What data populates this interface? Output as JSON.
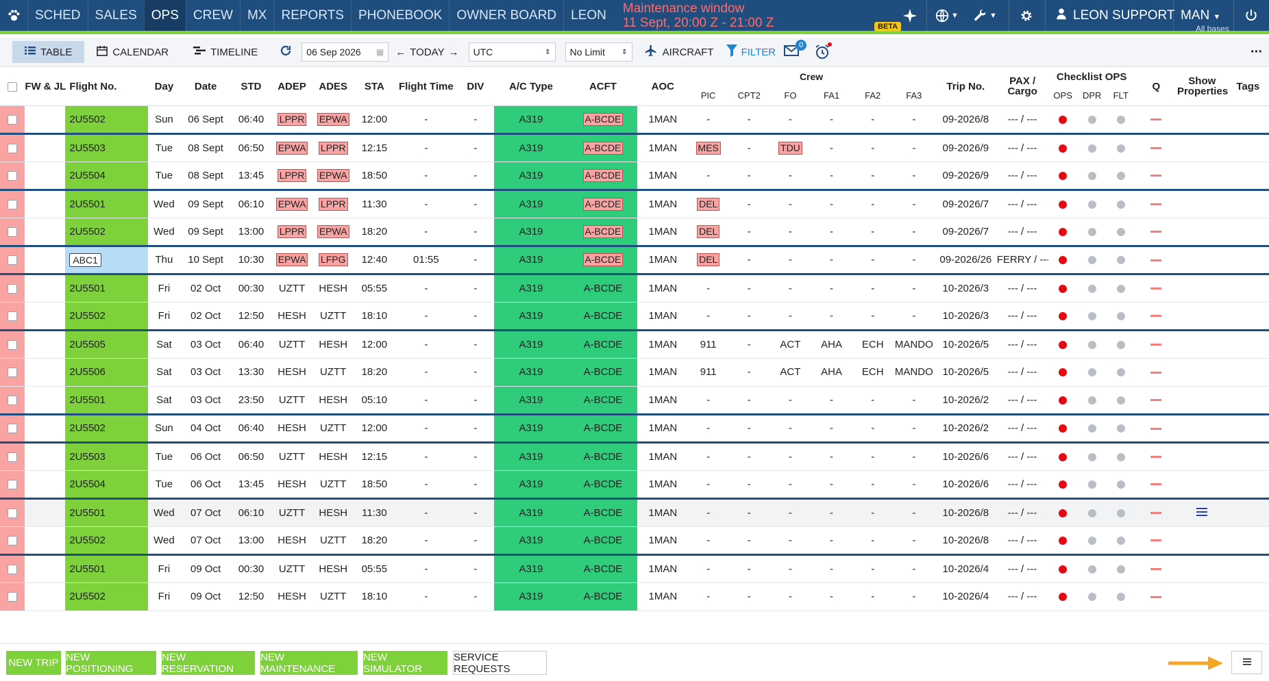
{
  "nav": {
    "items": [
      "SCHED",
      "SALES",
      "OPS",
      "CREW",
      "MX",
      "REPORTS",
      "PHONEBOOK",
      "OWNER BOARD",
      "LEON"
    ],
    "active": "OPS",
    "maintenance_title": "Maintenance window",
    "maintenance_time": "11 Sept, 20:00 Z - 21:00 Z",
    "beta_label": "BETA",
    "user_label": "LEON SUPPORT",
    "base_label": "MAN",
    "base_sub": "All bases"
  },
  "toolbar": {
    "views": [
      "TABLE",
      "CALENDAR",
      "TIMELINE"
    ],
    "active_view": "TABLE",
    "date_value": "06 Sep 2026",
    "today_label": "TODAY",
    "timezone_value": "UTC",
    "limit_value": "No Limit",
    "aircraft_label": "AIRCRAFT",
    "filter_label": "FILTER",
    "message_count": "0"
  },
  "columns": {
    "fw_jl": "FW & JL",
    "flight_no": "Flight No.",
    "day": "Day",
    "date": "Date",
    "std": "STD",
    "adep": "ADEP",
    "ades": "ADES",
    "sta": "STA",
    "flight_time": "Flight Time",
    "div": "DIV",
    "ac_type": "A/C Type",
    "acft": "ACFT",
    "aoc": "AOC",
    "crew": "Crew",
    "crew_sub": [
      "PIC",
      "CPT2",
      "FO",
      "FA1",
      "FA2",
      "FA3"
    ],
    "trip_no": "Trip No.",
    "pax_cargo_1": "PAX /",
    "pax_cargo_2": "Cargo",
    "checklist": "Checklist OPS",
    "checklist_sub": [
      "OPS",
      "DPR",
      "FLT"
    ],
    "q": "Q",
    "show_props_1": "Show",
    "show_props_2": "Properties",
    "tags": "Tags"
  },
  "rows": [
    {
      "flight": "2U5502",
      "day": "Sun",
      "date": "06 Sept",
      "std": "06:40",
      "adep": "LPPR",
      "ades": "EPWA",
      "sta": "12:00",
      "ft": "-",
      "div": "-",
      "type": "A319",
      "acft": "A-BCDE",
      "aoc": "1MAN",
      "pic": "-",
      "cpt2": "-",
      "fo": "-",
      "fa1": "-",
      "fa2": "-",
      "fa3": "-",
      "trip": "09-2026/8",
      "pax": "--- / ---",
      "tripstart": false,
      "flag_adep": true,
      "flag_ades": true,
      "flag_acft": true,
      "flag_pic": false,
      "flag_fo": false,
      "blue": false,
      "hl": false,
      "props": false
    },
    {
      "flight": "2U5503",
      "day": "Tue",
      "date": "08 Sept",
      "std": "06:50",
      "adep": "EPWA",
      "ades": "LPPR",
      "sta": "12:15",
      "ft": "-",
      "div": "-",
      "type": "A319",
      "acft": "A-BCDE",
      "aoc": "1MAN",
      "pic": "MES",
      "cpt2": "-",
      "fo": "TDU",
      "fa1": "-",
      "fa2": "-",
      "fa3": "-",
      "trip": "09-2026/9",
      "pax": "--- / ---",
      "tripstart": true,
      "flag_adep": true,
      "flag_ades": true,
      "flag_acft": true,
      "flag_pic": true,
      "flag_fo": true,
      "blue": false,
      "hl": false,
      "props": false
    },
    {
      "flight": "2U5504",
      "day": "Tue",
      "date": "08 Sept",
      "std": "13:45",
      "adep": "LPPR",
      "ades": "EPWA",
      "sta": "18:50",
      "ft": "-",
      "div": "-",
      "type": "A319",
      "acft": "A-BCDE",
      "aoc": "1MAN",
      "pic": "-",
      "cpt2": "-",
      "fo": "-",
      "fa1": "-",
      "fa2": "-",
      "fa3": "-",
      "trip": "09-2026/9",
      "pax": "--- / ---",
      "tripstart": false,
      "flag_adep": true,
      "flag_ades": true,
      "flag_acft": true,
      "flag_pic": false,
      "flag_fo": false,
      "blue": false,
      "hl": false,
      "props": false
    },
    {
      "flight": "2U5501",
      "day": "Wed",
      "date": "09 Sept",
      "std": "06:10",
      "adep": "EPWA",
      "ades": "LPPR",
      "sta": "11:30",
      "ft": "-",
      "div": "-",
      "type": "A319",
      "acft": "A-BCDE",
      "aoc": "1MAN",
      "pic": "DEL",
      "cpt2": "-",
      "fo": "-",
      "fa1": "-",
      "fa2": "-",
      "fa3": "-",
      "trip": "09-2026/7",
      "pax": "--- / ---",
      "tripstart": true,
      "flag_adep": true,
      "flag_ades": true,
      "flag_acft": true,
      "flag_pic": true,
      "flag_fo": false,
      "blue": false,
      "hl": false,
      "props": false
    },
    {
      "flight": "2U5502",
      "day": "Wed",
      "date": "09 Sept",
      "std": "13:00",
      "adep": "LPPR",
      "ades": "EPWA",
      "sta": "18:20",
      "ft": "-",
      "div": "-",
      "type": "A319",
      "acft": "A-BCDE",
      "aoc": "1MAN",
      "pic": "DEL",
      "cpt2": "-",
      "fo": "-",
      "fa1": "-",
      "fa2": "-",
      "fa3": "-",
      "trip": "09-2026/7",
      "pax": "--- / ---",
      "tripstart": false,
      "flag_adep": true,
      "flag_ades": true,
      "flag_acft": true,
      "flag_pic": true,
      "flag_fo": false,
      "blue": false,
      "hl": false,
      "props": false
    },
    {
      "flight": "ABC1",
      "day": "Thu",
      "date": "10 Sept",
      "std": "10:30",
      "adep": "EPWA",
      "ades": "LFPG",
      "sta": "12:40",
      "ft": "01:55",
      "div": "-",
      "type": "A319",
      "acft": "A-BCDE",
      "aoc": "1MAN",
      "pic": "DEL",
      "cpt2": "-",
      "fo": "-",
      "fa1": "-",
      "fa2": "-",
      "fa3": "-",
      "trip": "09-2026/26",
      "pax": "FERRY / ---",
      "tripstart": true,
      "flag_adep": true,
      "flag_ades": true,
      "flag_acft": true,
      "flag_pic": true,
      "flag_fo": false,
      "blue": true,
      "hl": false,
      "props": false
    },
    {
      "flight": "2U5501",
      "day": "Fri",
      "date": "02 Oct",
      "std": "00:30",
      "adep": "UZTT",
      "ades": "HESH",
      "sta": "05:55",
      "ft": "-",
      "div": "-",
      "type": "A319",
      "acft": "A-BCDE",
      "aoc": "1MAN",
      "pic": "-",
      "cpt2": "-",
      "fo": "-",
      "fa1": "-",
      "fa2": "-",
      "fa3": "-",
      "trip": "10-2026/3",
      "pax": "--- / ---",
      "tripstart": true,
      "flag_adep": false,
      "flag_ades": false,
      "flag_acft": false,
      "flag_pic": false,
      "flag_fo": false,
      "blue": false,
      "hl": false,
      "props": false
    },
    {
      "flight": "2U5502",
      "day": "Fri",
      "date": "02 Oct",
      "std": "12:50",
      "adep": "HESH",
      "ades": "UZTT",
      "sta": "18:10",
      "ft": "-",
      "div": "-",
      "type": "A319",
      "acft": "A-BCDE",
      "aoc": "1MAN",
      "pic": "-",
      "cpt2": "-",
      "fo": "-",
      "fa1": "-",
      "fa2": "-",
      "fa3": "-",
      "trip": "10-2026/3",
      "pax": "--- / ---",
      "tripstart": false,
      "flag_adep": false,
      "flag_ades": false,
      "flag_acft": false,
      "flag_pic": false,
      "flag_fo": false,
      "blue": false,
      "hl": false,
      "props": false
    },
    {
      "flight": "2U5505",
      "day": "Sat",
      "date": "03 Oct",
      "std": "06:40",
      "adep": "UZTT",
      "ades": "HESH",
      "sta": "12:00",
      "ft": "-",
      "div": "-",
      "type": "A319",
      "acft": "A-BCDE",
      "aoc": "1MAN",
      "pic": "911",
      "cpt2": "-",
      "fo": "ACT",
      "fa1": "AHA",
      "fa2": "ECH",
      "fa3": "MANDO",
      "trip": "10-2026/5",
      "pax": "--- / ---",
      "tripstart": true,
      "flag_adep": false,
      "flag_ades": false,
      "flag_acft": false,
      "flag_pic": false,
      "flag_fo": false,
      "blue": false,
      "hl": false,
      "props": false
    },
    {
      "flight": "2U5506",
      "day": "Sat",
      "date": "03 Oct",
      "std": "13:30",
      "adep": "HESH",
      "ades": "UZTT",
      "sta": "18:20",
      "ft": "-",
      "div": "-",
      "type": "A319",
      "acft": "A-BCDE",
      "aoc": "1MAN",
      "pic": "911",
      "cpt2": "-",
      "fo": "ACT",
      "fa1": "AHA",
      "fa2": "ECH",
      "fa3": "MANDO",
      "trip": "10-2026/5",
      "pax": "--- / ---",
      "tripstart": false,
      "flag_adep": false,
      "flag_ades": false,
      "flag_acft": false,
      "flag_pic": false,
      "flag_fo": false,
      "blue": false,
      "hl": false,
      "props": false
    },
    {
      "flight": "2U5501",
      "day": "Sat",
      "date": "03 Oct",
      "std": "23:50",
      "adep": "UZTT",
      "ades": "HESH",
      "sta": "05:10",
      "ft": "-",
      "div": "-",
      "type": "A319",
      "acft": "A-BCDE",
      "aoc": "1MAN",
      "pic": "-",
      "cpt2": "-",
      "fo": "-",
      "fa1": "-",
      "fa2": "-",
      "fa3": "-",
      "trip": "10-2026/2",
      "pax": "--- / ---",
      "tripstart": false,
      "flag_adep": false,
      "flag_ades": false,
      "flag_acft": false,
      "flag_pic": false,
      "flag_fo": false,
      "blue": false,
      "hl": false,
      "props": false
    },
    {
      "flight": "2U5502",
      "day": "Sun",
      "date": "04 Oct",
      "std": "06:40",
      "adep": "HESH",
      "ades": "UZTT",
      "sta": "12:00",
      "ft": "-",
      "div": "-",
      "type": "A319",
      "acft": "A-BCDE",
      "aoc": "1MAN",
      "pic": "-",
      "cpt2": "-",
      "fo": "-",
      "fa1": "-",
      "fa2": "-",
      "fa3": "-",
      "trip": "10-2026/2",
      "pax": "--- / ---",
      "tripstart": true,
      "flag_adep": false,
      "flag_ades": false,
      "flag_acft": false,
      "flag_pic": false,
      "flag_fo": false,
      "blue": false,
      "hl": false,
      "props": false
    },
    {
      "flight": "2U5503",
      "day": "Tue",
      "date": "06 Oct",
      "std": "06:50",
      "adep": "UZTT",
      "ades": "HESH",
      "sta": "12:15",
      "ft": "-",
      "div": "-",
      "type": "A319",
      "acft": "A-BCDE",
      "aoc": "1MAN",
      "pic": "-",
      "cpt2": "-",
      "fo": "-",
      "fa1": "-",
      "fa2": "-",
      "fa3": "-",
      "trip": "10-2026/6",
      "pax": "--- / ---",
      "tripstart": true,
      "flag_adep": false,
      "flag_ades": false,
      "flag_acft": false,
      "flag_pic": false,
      "flag_fo": false,
      "blue": false,
      "hl": false,
      "props": false
    },
    {
      "flight": "2U5504",
      "day": "Tue",
      "date": "06 Oct",
      "std": "13:45",
      "adep": "HESH",
      "ades": "UZTT",
      "sta": "18:50",
      "ft": "-",
      "div": "-",
      "type": "A319",
      "acft": "A-BCDE",
      "aoc": "1MAN",
      "pic": "-",
      "cpt2": "-",
      "fo": "-",
      "fa1": "-",
      "fa2": "-",
      "fa3": "-",
      "trip": "10-2026/6",
      "pax": "--- / ---",
      "tripstart": false,
      "flag_adep": false,
      "flag_ades": false,
      "flag_acft": false,
      "flag_pic": false,
      "flag_fo": false,
      "blue": false,
      "hl": false,
      "props": false
    },
    {
      "flight": "2U5501",
      "day": "Wed",
      "date": "07 Oct",
      "std": "06:10",
      "adep": "UZTT",
      "ades": "HESH",
      "sta": "11:30",
      "ft": "-",
      "div": "-",
      "type": "A319",
      "acft": "A-BCDE",
      "aoc": "1MAN",
      "pic": "-",
      "cpt2": "-",
      "fo": "-",
      "fa1": "-",
      "fa2": "-",
      "fa3": "-",
      "trip": "10-2026/8",
      "pax": "--- / ---",
      "tripstart": true,
      "flag_adep": false,
      "flag_ades": false,
      "flag_acft": false,
      "flag_pic": false,
      "flag_fo": false,
      "blue": false,
      "hl": true,
      "props": true
    },
    {
      "flight": "2U5502",
      "day": "Wed",
      "date": "07 Oct",
      "std": "13:00",
      "adep": "HESH",
      "ades": "UZTT",
      "sta": "18:20",
      "ft": "-",
      "div": "-",
      "type": "A319",
      "acft": "A-BCDE",
      "aoc": "1MAN",
      "pic": "-",
      "cpt2": "-",
      "fo": "-",
      "fa1": "-",
      "fa2": "-",
      "fa3": "-",
      "trip": "10-2026/8",
      "pax": "--- / ---",
      "tripstart": false,
      "flag_adep": false,
      "flag_ades": false,
      "flag_acft": false,
      "flag_pic": false,
      "flag_fo": false,
      "blue": false,
      "hl": false,
      "props": false
    },
    {
      "flight": "2U5501",
      "day": "Fri",
      "date": "09 Oct",
      "std": "00:30",
      "adep": "UZTT",
      "ades": "HESH",
      "sta": "05:55",
      "ft": "-",
      "div": "-",
      "type": "A319",
      "acft": "A-BCDE",
      "aoc": "1MAN",
      "pic": "-",
      "cpt2": "-",
      "fo": "-",
      "fa1": "-",
      "fa2": "-",
      "fa3": "-",
      "trip": "10-2026/4",
      "pax": "--- / ---",
      "tripstart": true,
      "flag_adep": false,
      "flag_ades": false,
      "flag_acft": false,
      "flag_pic": false,
      "flag_fo": false,
      "blue": false,
      "hl": false,
      "props": false
    },
    {
      "flight": "2U5502",
      "day": "Fri",
      "date": "09 Oct",
      "std": "12:50",
      "adep": "HESH",
      "ades": "UZTT",
      "sta": "18:10",
      "ft": "-",
      "div": "-",
      "type": "A319",
      "acft": "A-BCDE",
      "aoc": "1MAN",
      "pic": "-",
      "cpt2": "-",
      "fo": "-",
      "fa1": "-",
      "fa2": "-",
      "fa3": "-",
      "trip": "10-2026/4",
      "pax": "--- / ---",
      "tripstart": false,
      "flag_adep": false,
      "flag_ades": false,
      "flag_acft": false,
      "flag_pic": false,
      "flag_fo": false,
      "blue": false,
      "hl": false,
      "props": false
    }
  ],
  "footer": {
    "buttons": [
      "NEW TRIP",
      "NEW POSITIONING",
      "NEW RESERVATION",
      "NEW MAINTENANCE",
      "NEW SIMULATOR",
      "SERVICE REQUESTS"
    ]
  },
  "colors": {
    "nav_bg": "#1f4e7e",
    "accent_green": "#7fd13b",
    "ac_green": "#2fcc7c",
    "alert_red": "#e50914",
    "flag_pink": "#f9a3a3",
    "arrow_orange": "#f5a623"
  },
  "icons": [
    "paw-icon",
    "sparkle-icon",
    "globe-icon",
    "wrench-icon",
    "gear-icon",
    "user-icon",
    "power-icon",
    "table-icon",
    "calendar-icon",
    "timeline-icon",
    "refresh-icon",
    "calendar-small-icon",
    "arrow-left-icon",
    "arrow-right-icon",
    "plane-icon",
    "filter-icon",
    "mail-icon",
    "alarm-icon",
    "more-icon",
    "menu-icon",
    "arrow-icon"
  ]
}
